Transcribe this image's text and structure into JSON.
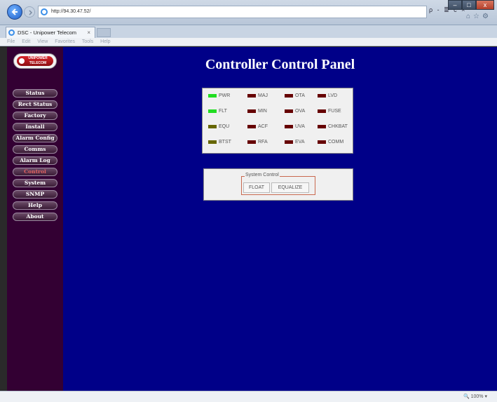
{
  "browser": {
    "url": "http://94.30.47.52/",
    "tab_title": "DSC - Unipower Telecom",
    "tab_close": "×",
    "menu": [
      "File",
      "Edit",
      "View",
      "Favorites",
      "Tools",
      "Help"
    ],
    "search_tools": "ρ - ≣ c ×",
    "window_buttons": [
      "–",
      "□",
      "x"
    ],
    "zoom": "🔍 100% ▾"
  },
  "logo": {
    "text": "UNIPOWER TELECOM"
  },
  "sidebar": {
    "items": [
      {
        "label": "Status",
        "active": false
      },
      {
        "label": "Rect Status",
        "active": false
      },
      {
        "label": "Factory",
        "active": false
      },
      {
        "label": "Install",
        "active": false
      },
      {
        "label": "Alarm Config",
        "active": false
      },
      {
        "label": "Comms",
        "active": false
      },
      {
        "label": "Alarm Log",
        "active": false
      },
      {
        "label": "Control",
        "active": true
      },
      {
        "label": "System",
        "active": false
      },
      {
        "label": "SNMP",
        "active": false
      },
      {
        "label": "Help",
        "active": false
      },
      {
        "label": "About",
        "active": false
      }
    ]
  },
  "main": {
    "title": "Controller Control Panel",
    "indicators": [
      {
        "label": "PWR",
        "color": "#22dd22"
      },
      {
        "label": "MAJ",
        "color": "#660000"
      },
      {
        "label": "OTA",
        "color": "#660000"
      },
      {
        "label": "LVD",
        "color": "#660000"
      },
      {
        "label": "FLT",
        "color": "#22dd22"
      },
      {
        "label": "MIN",
        "color": "#660000"
      },
      {
        "label": "OVA",
        "color": "#660000"
      },
      {
        "label": "FUSE",
        "color": "#660000"
      },
      {
        "label": "EQU",
        "color": "#666600"
      },
      {
        "label": "ACF",
        "color": "#660000"
      },
      {
        "label": "UVA",
        "color": "#660000"
      },
      {
        "label": "CHKBAT",
        "color": "#660000"
      },
      {
        "label": "BTST",
        "color": "#666600"
      },
      {
        "label": "RFA",
        "color": "#660000"
      },
      {
        "label": "EVA",
        "color": "#660000"
      },
      {
        "label": "COMM",
        "color": "#660000"
      }
    ],
    "system_control": {
      "legend": "System Control",
      "float_label": "FLOAT",
      "equalize_label": "EQUALIZE"
    }
  }
}
